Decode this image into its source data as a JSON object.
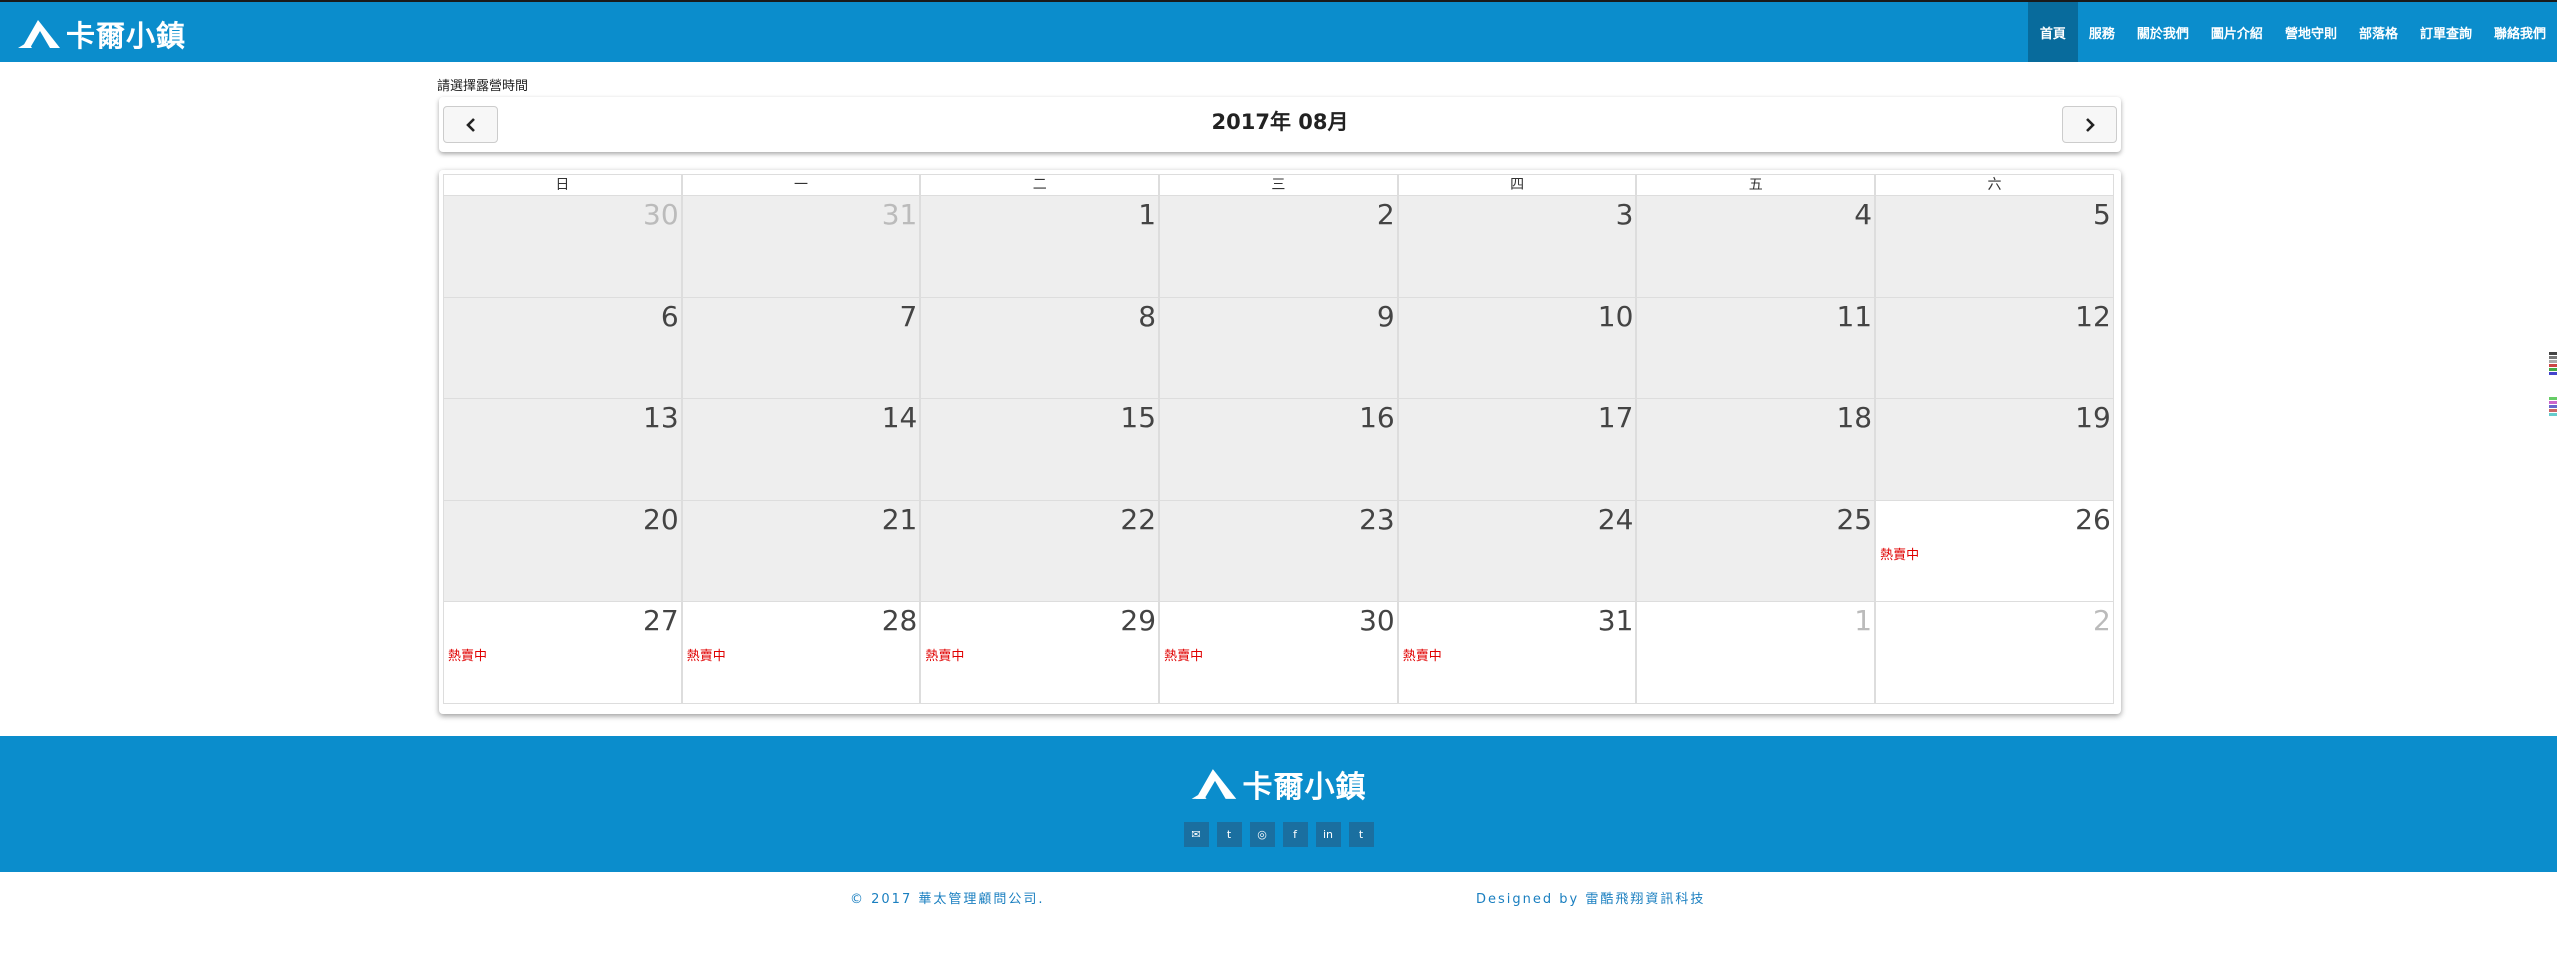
{
  "header": {
    "logo_text": "卡爾小鎮",
    "nav": [
      "首頁",
      "服務",
      "關於我們",
      "圖片介紹",
      "營地守則",
      "部落格",
      "訂單查詢",
      "聯絡我們"
    ]
  },
  "main": {
    "prompt": "請選擇露營時間",
    "month_title": "2017年 08月",
    "prev_icon": "chevron-left-icon",
    "next_icon": "chevron-right-icon",
    "weekdays": [
      "日",
      "一",
      "二",
      "三",
      "四",
      "五",
      "六"
    ],
    "days": [
      {
        "num": "30",
        "state": "past-other",
        "tag": ""
      },
      {
        "num": "31",
        "state": "past-other",
        "tag": ""
      },
      {
        "num": "1",
        "state": "past",
        "tag": ""
      },
      {
        "num": "2",
        "state": "past",
        "tag": ""
      },
      {
        "num": "3",
        "state": "past",
        "tag": ""
      },
      {
        "num": "4",
        "state": "past",
        "tag": ""
      },
      {
        "num": "5",
        "state": "past",
        "tag": ""
      },
      {
        "num": "6",
        "state": "past",
        "tag": ""
      },
      {
        "num": "7",
        "state": "past",
        "tag": ""
      },
      {
        "num": "8",
        "state": "past",
        "tag": ""
      },
      {
        "num": "9",
        "state": "past",
        "tag": ""
      },
      {
        "num": "10",
        "state": "past",
        "tag": ""
      },
      {
        "num": "11",
        "state": "past",
        "tag": ""
      },
      {
        "num": "12",
        "state": "past",
        "tag": ""
      },
      {
        "num": "13",
        "state": "past",
        "tag": ""
      },
      {
        "num": "14",
        "state": "past",
        "tag": ""
      },
      {
        "num": "15",
        "state": "past",
        "tag": ""
      },
      {
        "num": "16",
        "state": "past",
        "tag": ""
      },
      {
        "num": "17",
        "state": "past",
        "tag": ""
      },
      {
        "num": "18",
        "state": "past",
        "tag": ""
      },
      {
        "num": "19",
        "state": "past",
        "tag": ""
      },
      {
        "num": "20",
        "state": "past",
        "tag": ""
      },
      {
        "num": "21",
        "state": "past",
        "tag": ""
      },
      {
        "num": "22",
        "state": "past",
        "tag": ""
      },
      {
        "num": "23",
        "state": "past",
        "tag": ""
      },
      {
        "num": "24",
        "state": "past",
        "tag": ""
      },
      {
        "num": "25",
        "state": "past",
        "tag": ""
      },
      {
        "num": "26",
        "state": "open",
        "tag": "熱賣中"
      },
      {
        "num": "27",
        "state": "open",
        "tag": "熱賣中"
      },
      {
        "num": "28",
        "state": "open",
        "tag": "熱賣中"
      },
      {
        "num": "29",
        "state": "open",
        "tag": "熱賣中"
      },
      {
        "num": "30",
        "state": "open",
        "tag": "熱賣中"
      },
      {
        "num": "31",
        "state": "open",
        "tag": "熱賣中"
      },
      {
        "num": "1",
        "state": "other",
        "tag": ""
      },
      {
        "num": "2",
        "state": "other",
        "tag": ""
      }
    ]
  },
  "footer": {
    "logo_text": "卡爾小鎮",
    "socials": [
      {
        "icon": "mail-icon",
        "glyph": "✉"
      },
      {
        "icon": "twitter-icon",
        "glyph": "t"
      },
      {
        "icon": "dribbble-icon",
        "glyph": "◎"
      },
      {
        "icon": "facebook-icon",
        "glyph": "f"
      },
      {
        "icon": "linkedin-icon",
        "glyph": "in"
      },
      {
        "icon": "tumblr-icon",
        "glyph": "t"
      }
    ],
    "copyright": "© 2017 華太管理顧問公司.",
    "designed_by": "Designed by 雷酷飛翔資訊科技"
  },
  "colors": {
    "brand_blue": "#0b8dcc",
    "active_nav": "#086b9c",
    "hot_tag": "#e00000",
    "past_day_bg": "#eeeeee"
  }
}
